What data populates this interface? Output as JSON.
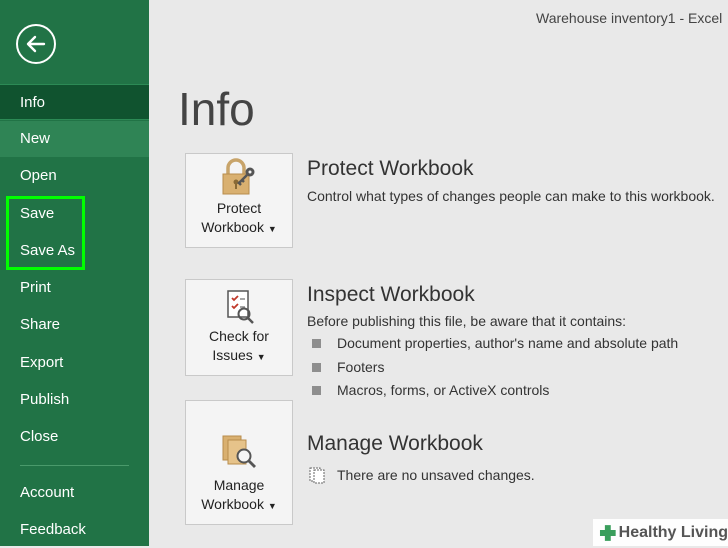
{
  "window": {
    "title": "Warehouse inventory1  -  Excel"
  },
  "sidebar": {
    "items": [
      {
        "label": "Info"
      },
      {
        "label": "New"
      },
      {
        "label": "Open"
      },
      {
        "label": "Save"
      },
      {
        "label": "Save As"
      },
      {
        "label": "Print"
      },
      {
        "label": "Share"
      },
      {
        "label": "Export"
      },
      {
        "label": "Publish"
      },
      {
        "label": "Close"
      }
    ],
    "footer": [
      {
        "label": "Account"
      },
      {
        "label": "Feedback"
      }
    ]
  },
  "main": {
    "title": "Info",
    "protect": {
      "button_line1": "Protect",
      "button_line2": "Workbook",
      "title": "Protect Workbook",
      "desc": "Control what types of changes people can make to this workbook."
    },
    "inspect": {
      "button_line1": "Check for",
      "button_line2": "Issues",
      "title": "Inspect Workbook",
      "desc": "Before publishing this file, be aware that it contains:",
      "bullets": [
        "Document properties, author's name and absolute path",
        "Footers",
        "Macros, forms, or ActiveX controls"
      ]
    },
    "manage": {
      "button_line1": "Manage",
      "button_line2": "Workbook",
      "title": "Manage Workbook",
      "desc": "There are no unsaved changes."
    }
  },
  "watermark": {
    "text": "Healthy Living"
  },
  "colors": {
    "sidebar": "#217346",
    "highlight": "#00ff00",
    "background": "#e9e9e9"
  }
}
